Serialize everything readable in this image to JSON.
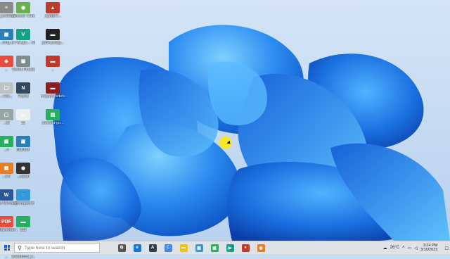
{
  "desktop": {
    "icons": [
      {
        "label": "...gonidoes",
        "color": "#8a8a8a",
        "glyph": "≡"
      },
      {
        "label": "Browser Cam",
        "color": "#6ab04c",
        "glyph": "◉"
      },
      {
        "label": "Lightpro...",
        "color": "#c0392b",
        "glyph": "▲"
      },
      {
        "label": "...ding...",
        "color": "#2980b9",
        "glyph": "▦"
      },
      {
        "label": "CTVA jpk... Shortcut",
        "color": "#16a085",
        "glyph": "V"
      },
      {
        "label": "gallerymag...",
        "color": "#222222",
        "glyph": "▬"
      },
      {
        "label": "...",
        "color": "#e74c3c",
        "glyph": "◆"
      },
      {
        "label": "Tosha-Pinakit",
        "color": "#7f8c8d",
        "glyph": "▣"
      },
      {
        "label": "...",
        "color": "#c0392b",
        "glyph": "▬"
      },
      {
        "label": "...Tea...",
        "color": "#bdc3c7",
        "glyph": "▢"
      },
      {
        "label": "Pipefit",
        "color": "#34495e",
        "glyph": "N"
      },
      {
        "label": "mayanresdefa...",
        "color": "#8e1e1e",
        "glyph": "▬"
      },
      {
        "label": "...ob",
        "color": "#95a5a6",
        "glyph": "▢"
      },
      {
        "label": "22",
        "color": "#ecf0f1",
        "glyph": "▭"
      },
      {
        "label": "utorrent-go...",
        "color": "#27ae60",
        "glyph": "▤"
      },
      {
        "label": "...s",
        "color": "#27ae60",
        "glyph": "▣"
      },
      {
        "label": "Biashan",
        "color": "#2980b9",
        "glyph": "▣"
      },
      {
        "label": "...s 5",
        "color": "#e67e22",
        "glyph": "▦"
      },
      {
        "label": "New Microsoft...",
        "color": "#2b579a",
        "glyph": "W"
      },
      {
        "label": "...ulean",
        "color": "#333333",
        "glyph": "◉"
      },
      {
        "label": "Tosha-Khan...",
        "color": "#e74c3c",
        "glyph": "PDF"
      },
      {
        "label": "...p snapshot",
        "color": "#3498db",
        "glyph": "◌"
      },
      {
        "label": "222",
        "color": "#27ae60",
        "glyph": "▬"
      },
      {
        "label": "...",
        "color": "#8e44ad",
        "glyph": "◍"
      },
      {
        "label": "20230313_2...",
        "color": "#ecf0f1",
        "glyph": "▭"
      }
    ]
  },
  "taskbar": {
    "search_placeholder": "Type here to search",
    "apps": [
      {
        "name": "task-view",
        "color": "#555555",
        "glyph": "⧉"
      },
      {
        "name": "edge",
        "color": "#0f7ad8",
        "glyph": "e"
      },
      {
        "name": "app-dark",
        "color": "#2c3e50",
        "glyph": "A"
      },
      {
        "name": "chrome-like",
        "color": "#4285f4",
        "glyph": "C"
      },
      {
        "name": "files",
        "color": "#f1c40f",
        "glyph": "▬"
      },
      {
        "name": "store",
        "color": "#3498db",
        "glyph": "▦"
      },
      {
        "name": "image-app",
        "color": "#27ae60",
        "glyph": "▣"
      },
      {
        "name": "media",
        "color": "#16a085",
        "glyph": "▶"
      },
      {
        "name": "recorder",
        "color": "#c0392b",
        "glyph": "●"
      },
      {
        "name": "browser",
        "color": "#e67e22",
        "glyph": "◉"
      }
    ],
    "tray": {
      "weather": "26°C",
      "time": "3:24 PM",
      "date": "3/16/2023"
    }
  }
}
